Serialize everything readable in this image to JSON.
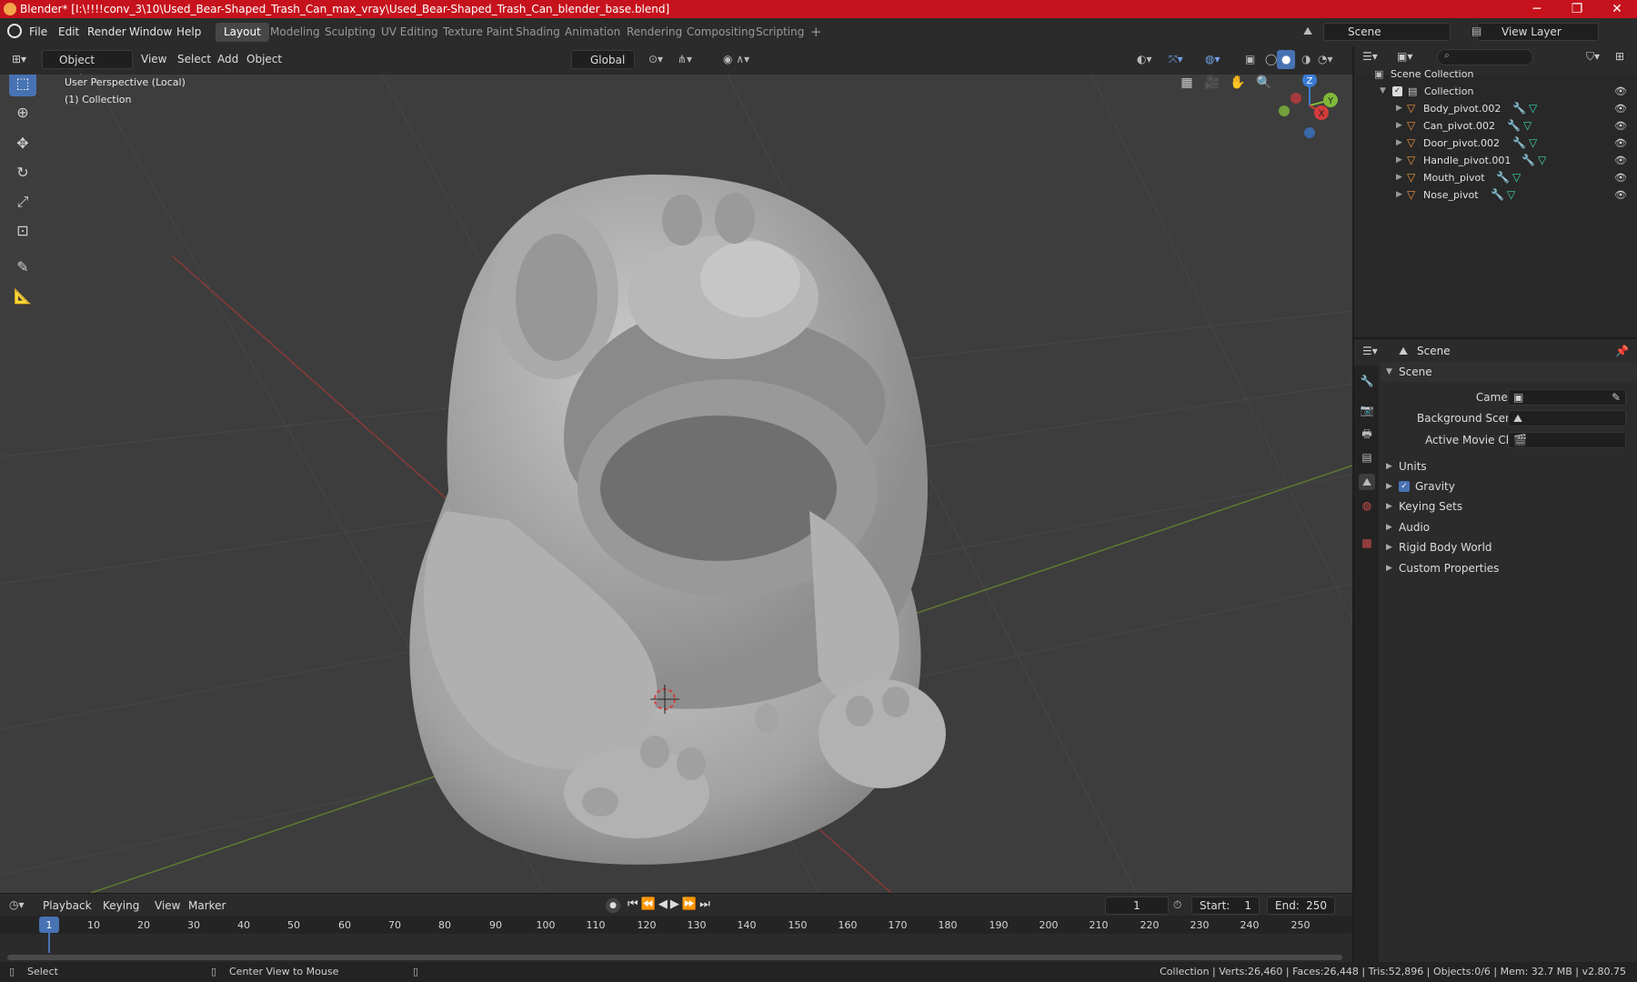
{
  "window": {
    "title": "Blender* [I:\\!!!!conv_3\\10\\Used_Bear-Shaped_Trash_Can_max_vray\\Used_Bear-Shaped_Trash_Can_blender_base.blend]",
    "minimize": "─",
    "maximize": "❐",
    "close": "✕",
    "title_bar_color": "#c6121d"
  },
  "menubar": {
    "items": [
      "File",
      "Edit",
      "Render",
      "Window",
      "Help"
    ],
    "workspaces": [
      "Layout",
      "Modeling",
      "Sculpting",
      "UV Editing",
      "Texture Paint",
      "Shading",
      "Animation",
      "Rendering",
      "Compositing",
      "Scripting"
    ],
    "active_workspace": "Layout",
    "add_workspace": "+",
    "scene_label": "Scene",
    "view_layer_label": "View Layer"
  },
  "viewport_header": {
    "mode": "Object Mode",
    "menus": [
      "View",
      "Select",
      "Add",
      "Object"
    ],
    "transform_orientation": "Global"
  },
  "viewport": {
    "overlay_line1": "User Perspective (Local)",
    "overlay_line2": "(1) Collection",
    "gizmo_axes": [
      "Z",
      "Y",
      "X"
    ],
    "background_color": "#3d3d3d",
    "accent_color": "#4772b3"
  },
  "outliner": {
    "root": "Scene Collection",
    "collection": "Collection",
    "objects": [
      "Body_pivot.002",
      "Can_pivot.002",
      "Door_pivot.002",
      "Handle_pivot.001",
      "Mouth_pivot",
      "Nose_pivot"
    ]
  },
  "properties": {
    "header_title": "Scene",
    "panel_title": "Scene",
    "fields": [
      {
        "label": "Camera"
      },
      {
        "label": "Background Scene"
      },
      {
        "label": "Active Movie Clip"
      }
    ],
    "subpanels": [
      "Units",
      "Gravity",
      "Keying Sets",
      "Audio",
      "Rigid Body World",
      "Custom Properties"
    ],
    "gravity_checked": true
  },
  "timeline": {
    "menus": [
      "Playback",
      "Keying",
      "View",
      "Marker"
    ],
    "current_frame": "1",
    "start_label": "Start:",
    "start_value": "1",
    "end_label": "End:",
    "end_value": "250",
    "ruler": [
      "1",
      "10",
      "20",
      "30",
      "40",
      "50",
      "60",
      "70",
      "80",
      "90",
      "100",
      "110",
      "120",
      "130",
      "140",
      "150",
      "160",
      "170",
      "180",
      "190",
      "200",
      "210",
      "220",
      "230",
      "240",
      "250"
    ]
  },
  "statusbar": {
    "select": "Select",
    "center_view": "Center View to Mouse",
    "stats": "Collection | Verts:26,460 | Faces:26,448 | Tris:52,896 | Objects:0/6 | Mem: 32.7 MB | v2.80.75"
  }
}
